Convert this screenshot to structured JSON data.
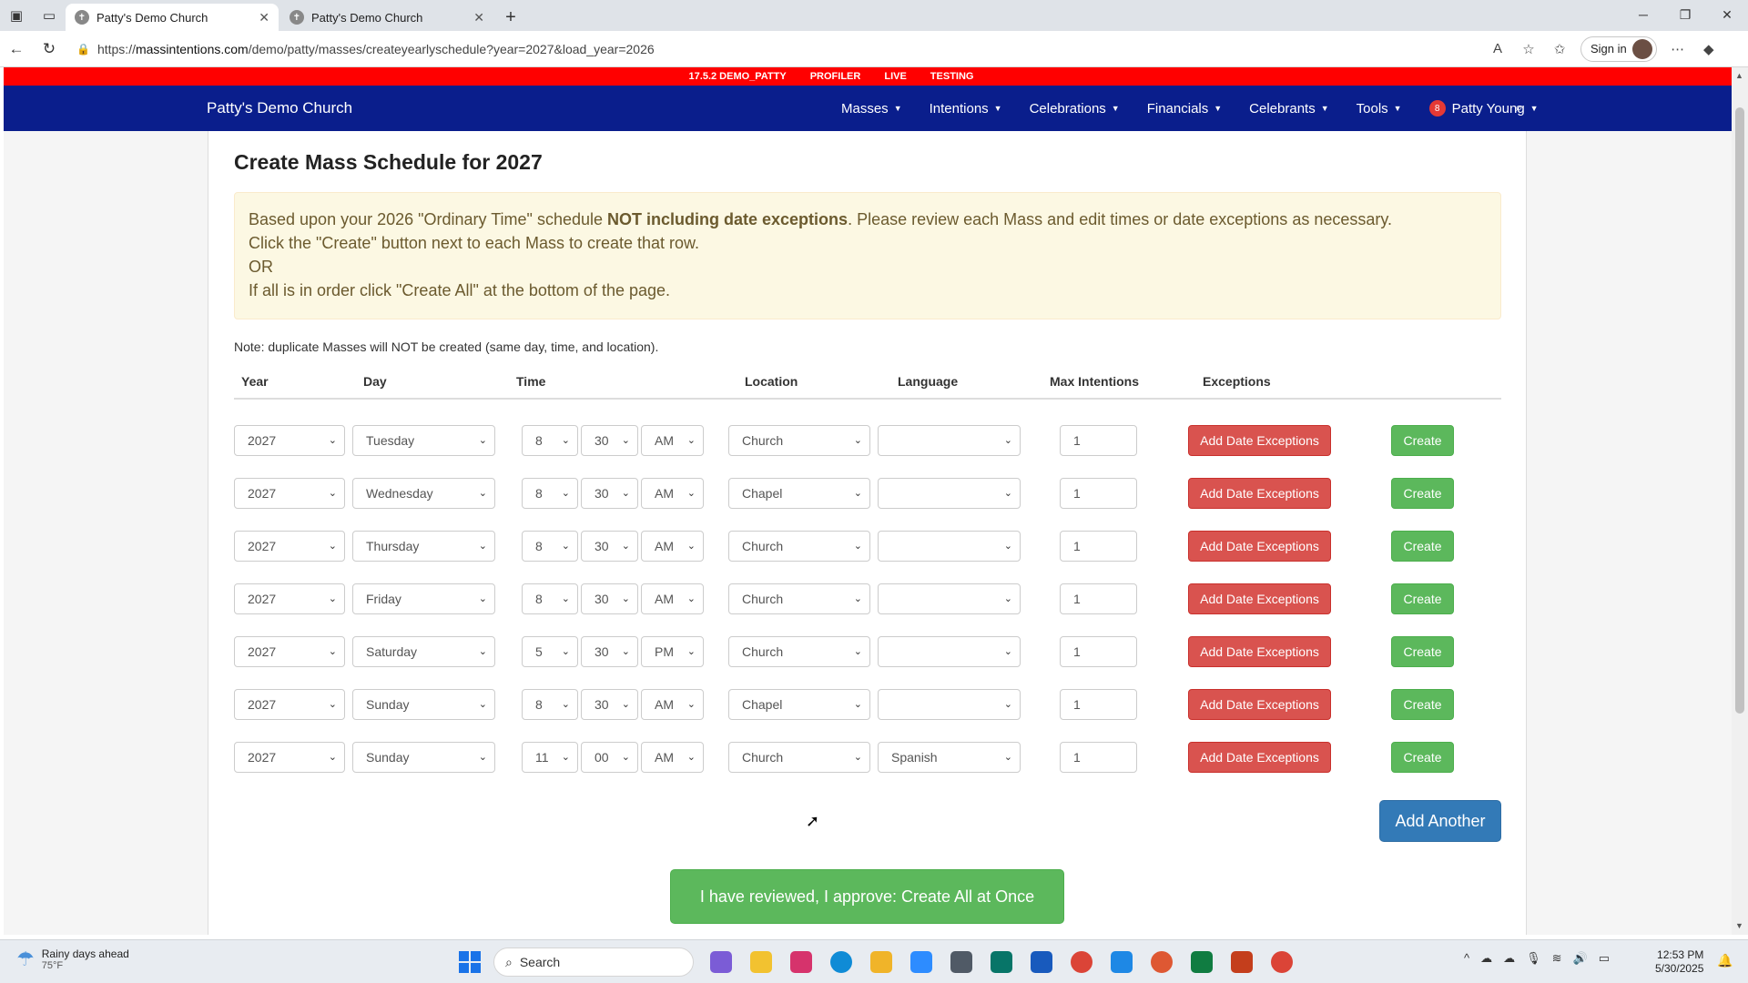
{
  "browser": {
    "tabs": [
      {
        "title": "Patty's Demo Church",
        "active": true
      },
      {
        "title": "Patty's Demo Church",
        "active": false
      }
    ],
    "url_prefix": "https://",
    "url_host": "massintentions.com",
    "url_path": "/demo/patty/masses/createyearlyschedule?year=2027&load_year=2026",
    "signin_label": "Sign in"
  },
  "envbar": [
    "17.5.2 DEMO_PATTY",
    "PROFILER",
    "LIVE",
    "TESTING"
  ],
  "navbar": {
    "brand": "Patty's Demo Church",
    "menu": [
      "Masses",
      "Intentions",
      "Celebrations",
      "Financials",
      "Celebrants",
      "Tools"
    ],
    "user_badge": "8",
    "user_name": "Patty Young"
  },
  "page": {
    "title": "Create Mass Schedule for 2027",
    "alert_line1_a": "Based upon your 2026 \"Ordinary Time\" schedule ",
    "alert_line1_b": "NOT including date exceptions",
    "alert_line1_c": ". Please review each Mass and edit times or date exceptions as necessary.",
    "alert_line2": "Click the \"Create\" button next to each Mass to create that row.",
    "alert_line3": "OR",
    "alert_line4": "If all is in order click \"Create All\" at the bottom of the page.",
    "note": "Note: duplicate Masses will NOT be created (same day, time, and location)."
  },
  "table": {
    "headers": {
      "year": "Year",
      "day": "Day",
      "time": "Time",
      "location": "Location",
      "language": "Language",
      "max_intentions": "Max Intentions",
      "exceptions": "Exceptions"
    },
    "exceptions_button": "Add Date Exceptions",
    "create_button": "Create",
    "rows": [
      {
        "year": "2027",
        "day": "Tuesday",
        "hour": "8",
        "minute": "30",
        "ampm": "AM",
        "location": "Church",
        "language": "",
        "max": "1"
      },
      {
        "year": "2027",
        "day": "Wednesday",
        "hour": "8",
        "minute": "30",
        "ampm": "AM",
        "location": "Chapel",
        "language": "",
        "max": "1"
      },
      {
        "year": "2027",
        "day": "Thursday",
        "hour": "8",
        "minute": "30",
        "ampm": "AM",
        "location": "Church",
        "language": "",
        "max": "1"
      },
      {
        "year": "2027",
        "day": "Friday",
        "hour": "8",
        "minute": "30",
        "ampm": "AM",
        "location": "Church",
        "language": "",
        "max": "1"
      },
      {
        "year": "2027",
        "day": "Saturday",
        "hour": "5",
        "minute": "30",
        "ampm": "PM",
        "location": "Church",
        "language": "",
        "max": "1"
      },
      {
        "year": "2027",
        "day": "Sunday",
        "hour": "8",
        "minute": "30",
        "ampm": "AM",
        "location": "Chapel",
        "language": "",
        "max": "1"
      },
      {
        "year": "2027",
        "day": "Sunday",
        "hour": "11",
        "minute": "00",
        "ampm": "AM",
        "location": "Church",
        "language": "Spanish",
        "max": "1"
      }
    ]
  },
  "actions": {
    "add_another": "Add Another",
    "create_all": "I have reviewed, I approve: Create All at Once"
  },
  "taskbar": {
    "weather_title": "Rainy days ahead",
    "weather_temp": "75°F",
    "search_placeholder": "Search",
    "time": "12:53 PM",
    "date": "5/30/2025"
  }
}
